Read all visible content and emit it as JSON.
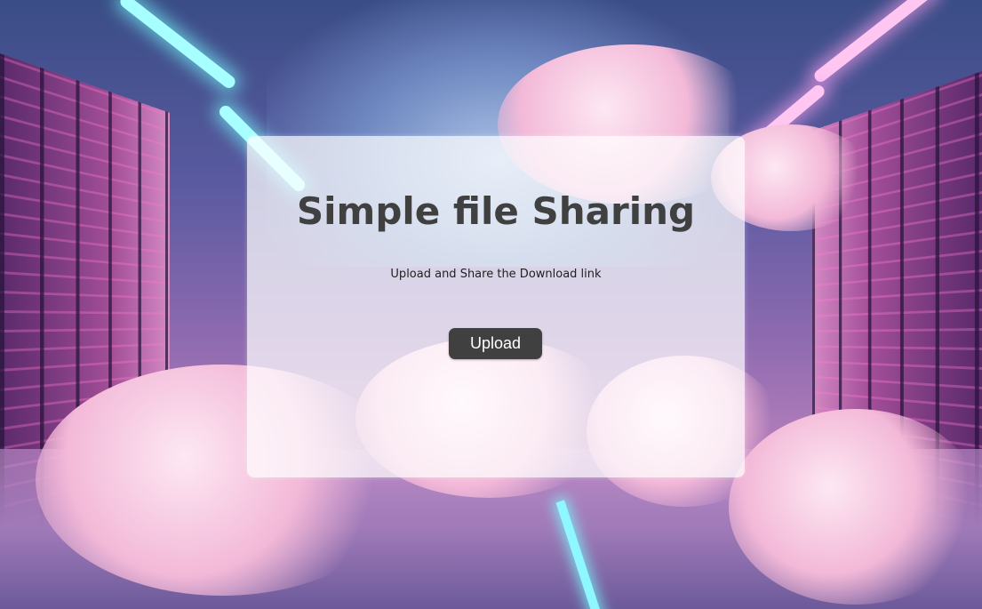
{
  "card": {
    "title": "Simple file Sharing",
    "subtitle": "Upload and Share the Download link",
    "upload_label": "Upload"
  },
  "colors": {
    "title_text": "#404040",
    "button_bg": "#404040",
    "button_text": "#ffffff",
    "card_bg": "rgba(255,255,255,0.72)"
  },
  "background": {
    "description_icon": "server-room-clouds-background"
  }
}
